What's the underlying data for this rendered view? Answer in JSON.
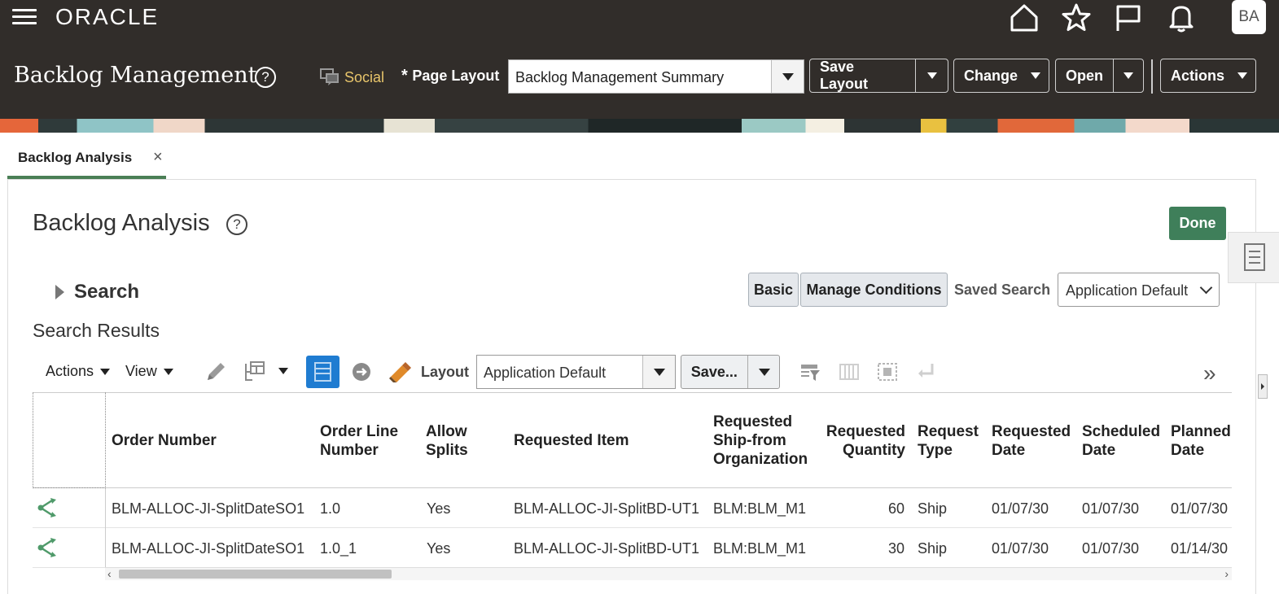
{
  "header": {
    "logo": "ORACLE",
    "avatar": "BA",
    "page_title": "Backlog Management",
    "social": "Social",
    "page_layout_label": "Page Layout",
    "page_layout_value": "Backlog Management Summary",
    "buttons": {
      "save_layout": "Save Layout",
      "change": "Change",
      "open": "Open",
      "actions": "Actions"
    },
    "icons": [
      "home-icon",
      "favorites-icon",
      "watchlist-icon",
      "notifications-icon"
    ]
  },
  "tab": {
    "label": "Backlog Analysis"
  },
  "content": {
    "title": "Backlog Analysis",
    "done": "Done",
    "search_label": "Search",
    "basic": "Basic",
    "manage_conditions": "Manage Conditions",
    "saved_search_label": "Saved Search",
    "saved_search_value": "Application Default",
    "results_title": "Search Results"
  },
  "toolbar": {
    "actions": "Actions",
    "view": "View",
    "layout_label": "Layout",
    "layout_value": "Application Default",
    "save": "Save..."
  },
  "table": {
    "columns": [
      {
        "key": "order_number",
        "label": "Order Number"
      },
      {
        "key": "order_line",
        "label": "Order Line Number"
      },
      {
        "key": "allow_splits",
        "label": "Allow Splits"
      },
      {
        "key": "requested_item",
        "label": "Requested Item"
      },
      {
        "key": "ship_from",
        "label": "Requested Ship-from Organization"
      },
      {
        "key": "req_qty",
        "label": "Requested Quantity"
      },
      {
        "key": "request_type",
        "label": "Request Type"
      },
      {
        "key": "requested_date",
        "label": "Requested Date"
      },
      {
        "key": "scheduled_date",
        "label": "Scheduled Date"
      },
      {
        "key": "planned_date",
        "label": "Planned Date"
      }
    ],
    "header_text": {
      "order_number": "Order Number",
      "order_line_1": "Order Line",
      "order_line_2": "Number",
      "allow_splits_1": "Allow",
      "allow_splits_2": "Splits",
      "requested_item": "Requested Item",
      "ship_from_1": "Requested",
      "ship_from_2": "Ship-from",
      "ship_from_3": "Organization",
      "req_qty_1": "Requested",
      "req_qty_2": "Quantity",
      "request_type_1": "Request",
      "request_type_2": "Type",
      "requested_date_1": "Requested",
      "requested_date_2": "Date",
      "scheduled_date_1": "Scheduled",
      "scheduled_date_2": "Date",
      "planned_date_1": "Planned",
      "planned_date_2": "Date"
    },
    "rows": [
      {
        "order_number": "BLM-ALLOC-JI-SplitDateSO1",
        "order_line": "1.0",
        "allow_splits": "Yes",
        "requested_item": "BLM-ALLOC-JI-SplitBD-UT1",
        "ship_from": "BLM:BLM_M1",
        "req_qty": "60",
        "request_type": "Ship",
        "requested_date": "01/07/30",
        "scheduled_date": "01/07/30",
        "planned_date": "01/07/30"
      },
      {
        "order_number": "BLM-ALLOC-JI-SplitDateSO1",
        "order_line": "1.0_1",
        "allow_splits": "Yes",
        "requested_item": "BLM-ALLOC-JI-SplitBD-UT1",
        "ship_from": "BLM:BLM_M1",
        "req_qty": "30",
        "request_type": "Ship",
        "requested_date": "01/07/30",
        "scheduled_date": "01/07/30",
        "planned_date": "01/14/30"
      }
    ]
  },
  "colors": {
    "header_bg": "#312d2a",
    "accent_green": "#3f7f5a",
    "social_gold": "#e8c56b",
    "detach_blue": "#1f7cd1"
  }
}
